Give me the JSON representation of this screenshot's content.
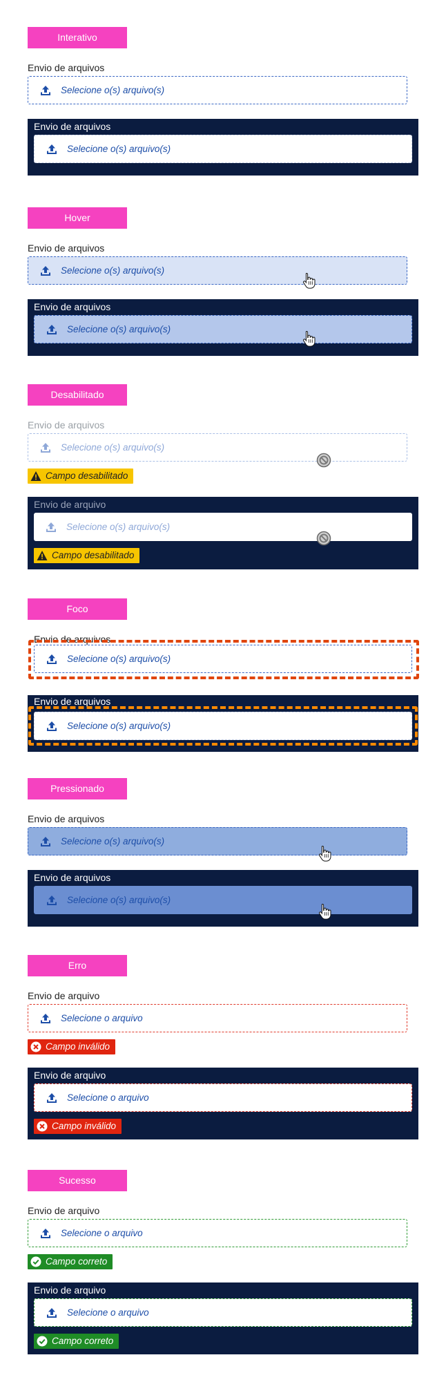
{
  "sections": [
    {
      "tag": "Interativo",
      "light": {
        "label": "Envio de arquivos",
        "placeholder": "Selecione o(s) arquivo(s)"
      },
      "dark": {
        "label": "Envio de arquivos",
        "placeholder": "Selecione o(s) arquivo(s)"
      }
    },
    {
      "tag": "Hover",
      "light": {
        "label": "Envio de arquivos",
        "placeholder": "Selecione o(s) arquivo(s)"
      },
      "dark": {
        "label": "Envio de arquivos",
        "placeholder": "Selecione o(s) arquivo(s)"
      }
    },
    {
      "tag": "Desabilitado",
      "light": {
        "label": "Envio de arquivos",
        "placeholder": "Selecione o(s) arquivo(s)",
        "message": "Campo desabilitado"
      },
      "dark": {
        "label": "Envio de arquivo",
        "placeholder": "Selecione o(s) arquivo(s)",
        "message": "Campo desabilitado"
      }
    },
    {
      "tag": "Foco",
      "light": {
        "label": "Envio de arquivos",
        "placeholder": "Selecione o(s) arquivo(s)"
      },
      "dark": {
        "label": "Envio de arquivos",
        "placeholder": "Selecione o(s) arquivo(s)"
      }
    },
    {
      "tag": "Pressionado",
      "light": {
        "label": "Envio de arquivos",
        "placeholder": "Selecione o(s) arquivo(s)"
      },
      "dark": {
        "label": "Envio de arquivos",
        "placeholder": "Selecione o(s) arquivo(s)"
      }
    },
    {
      "tag": "Erro",
      "light": {
        "label": "Envio de arquivo",
        "placeholder": "Selecione o arquivo",
        "message": "Campo inválido"
      },
      "dark": {
        "label": "Envio de arquivo",
        "placeholder": "Selecione o arquivo",
        "message": "Campo inválido"
      }
    },
    {
      "tag": "Sucesso",
      "light": {
        "label": "Envio de arquivo",
        "placeholder": "Selecione o arquivo",
        "message": "Campo correto"
      },
      "dark": {
        "label": "Envio de arquivo",
        "placeholder": "Selecione o arquivo",
        "message": "Campo correto"
      }
    }
  ],
  "colors": {
    "tag": "#f542c0",
    "dark_background": "#0b1c40",
    "field_text": "#1d4ea8",
    "focus_light": "#e0450d",
    "focus_dark": "#ff8a00",
    "warning": "#f7c500",
    "error": "#e0250f",
    "success": "#1f8c26"
  },
  "icons": {
    "upload": "upload-icon",
    "hand_cursor": "hand-cursor-icon",
    "not_allowed_cursor": "not-allowed-cursor-icon",
    "warning": "warning-icon",
    "error": "error-circle-icon",
    "success": "check-circle-icon"
  }
}
